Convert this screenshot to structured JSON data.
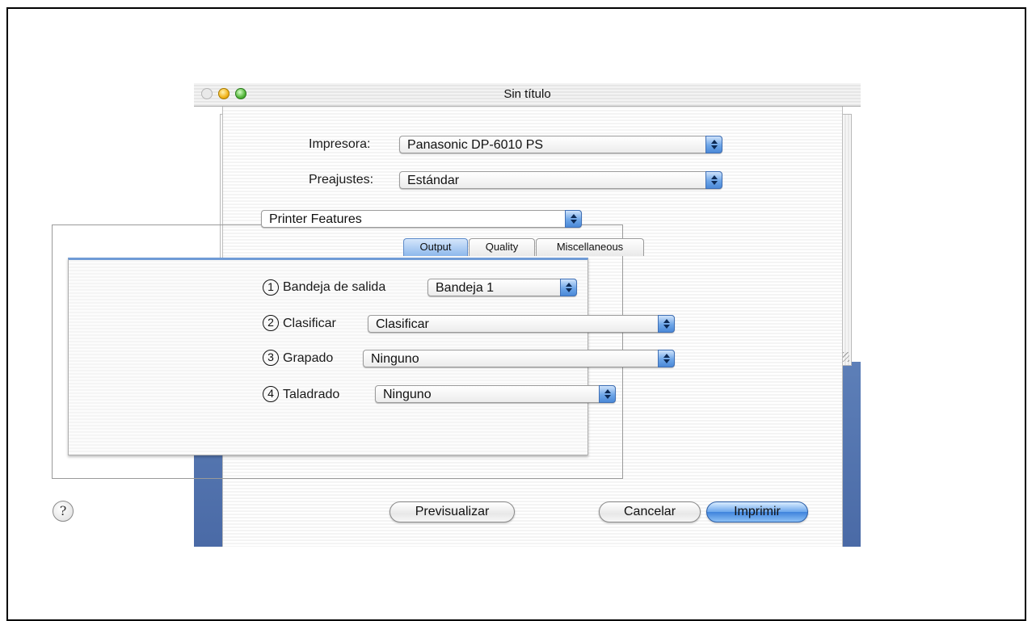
{
  "window": {
    "title": "Sin título"
  },
  "printer": {
    "label": "Impresora:",
    "value": "Panasonic DP-6010 PS"
  },
  "presets": {
    "label": "Preajustes:",
    "value": "Estándar"
  },
  "panel": {
    "value": "Printer Features"
  },
  "tabs": [
    {
      "label": "Output",
      "active": true
    },
    {
      "label": "Quality",
      "active": false
    },
    {
      "label": "Miscellaneous",
      "active": false
    }
  ],
  "options": [
    {
      "number": "1",
      "label": "Bandeja de salida",
      "value": "Bandeja 1"
    },
    {
      "number": "2",
      "label": "Clasificar",
      "value": "Clasificar"
    },
    {
      "number": "3",
      "label": "Grapado",
      "value": "Ninguno"
    },
    {
      "number": "4",
      "label": "Taladrado",
      "value": "Ninguno"
    }
  ],
  "buttons": {
    "help": "?",
    "preview": "Previsualizar",
    "cancel": "Cancelar",
    "print": "Imprimir"
  },
  "colors": {
    "accent": "#4b89d8",
    "desktop": "#5d7fb8"
  }
}
